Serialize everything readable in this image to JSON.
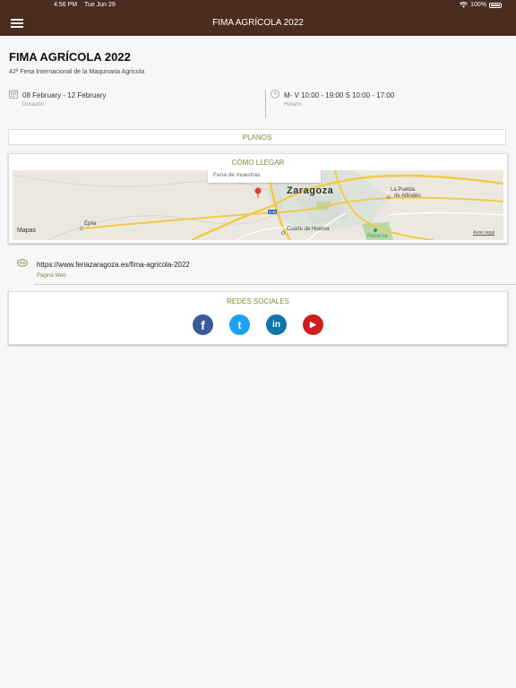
{
  "status": {
    "time": "4:56 PM",
    "date": "Tue Jun 29",
    "battery": "100%"
  },
  "nav": {
    "title": "FIMA AGRÍCOLA 2022"
  },
  "event": {
    "title": "FIMA AGRÍCOLA 2022",
    "subtitle": "42ª Feria Internacional de la Maquinaria Agrícola",
    "duration_value": "08 February - 12 February",
    "duration_label": "Duración",
    "schedule_value": "M- V 10:00 - 19:00 S 10:00 - 17:00",
    "schedule_label": "Horario"
  },
  "planos": {
    "label": "PLANOS"
  },
  "map": {
    "title": "CÓMO LLEGAR",
    "callout": "Feria de muestras",
    "city": "Zaragoza",
    "labels": {
      "puebla1": "La Puebla",
      "puebla2": "de Alfindén",
      "epila": "Épila",
      "cuarte": "Cuarte de Huerva",
      "reserva": "Reserva",
      "road": "Z-40"
    },
    "attribution": "Mapas",
    "legal": "Aviso legal"
  },
  "web": {
    "url": "https://www.feriazaragoza.es/fima-agricola-2022",
    "label": "Página Web"
  },
  "social": {
    "title": "REDES SOCIALES",
    "items": [
      {
        "name": "facebook",
        "glyph": "f",
        "color": "#3b5998"
      },
      {
        "name": "twitter",
        "glyph": "t",
        "color": "#1da1f2"
      },
      {
        "name": "linkedin",
        "glyph": "in",
        "color": "#0e76a8"
      },
      {
        "name": "youtube",
        "glyph": "▶",
        "color": "#cc1f1f"
      }
    ]
  },
  "colors": {
    "navbar": "#4a2d1f",
    "accent": "#7a8a3a"
  }
}
